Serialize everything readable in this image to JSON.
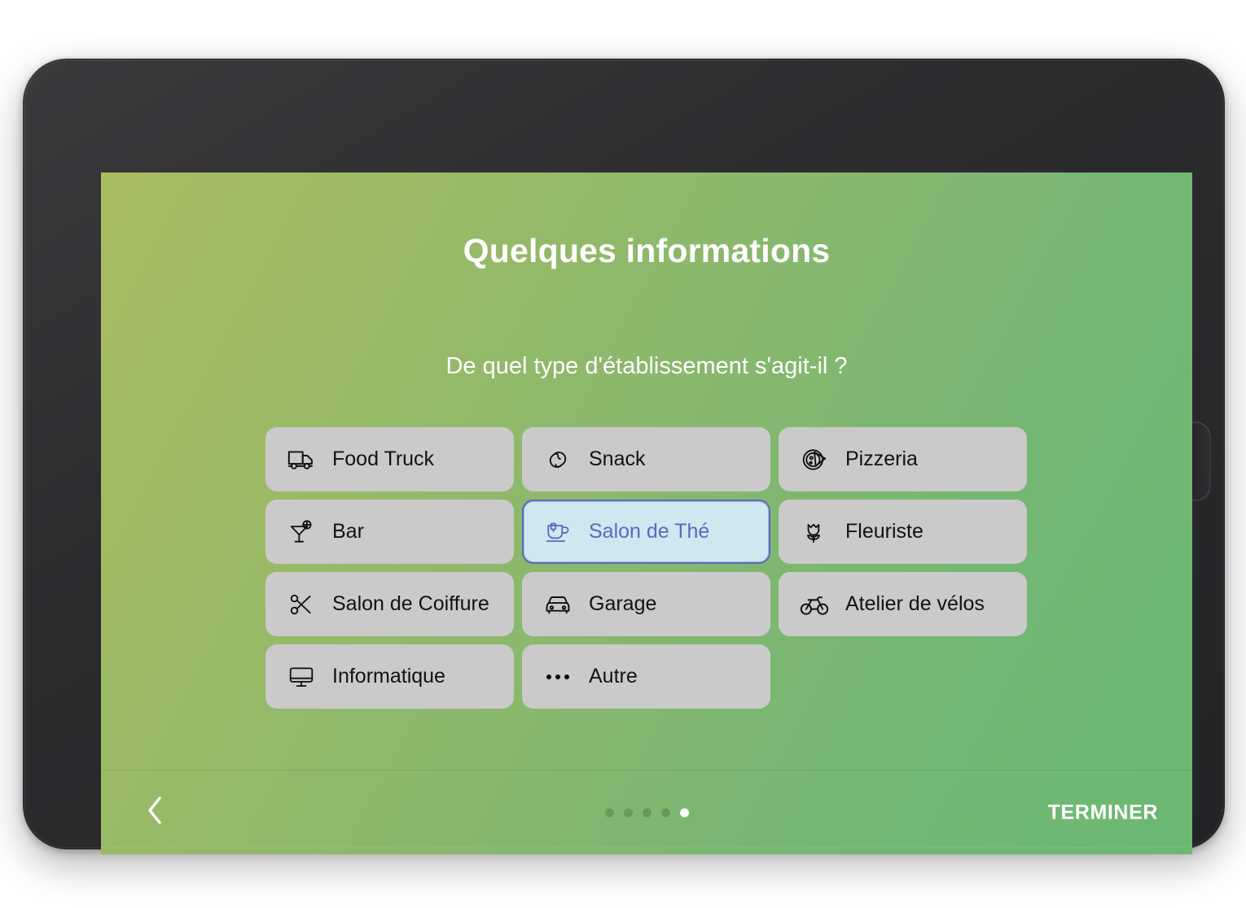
{
  "device": {
    "type": "tablet",
    "frame_color": "#2c2c2f",
    "side_button_name": "home-button"
  },
  "screen": {
    "background_gradient_from": "#a9bd60",
    "background_gradient_to": "#6bb873"
  },
  "header": {
    "title": "Quelques informations",
    "question": "De quel type d'établissement s'agit-il ?"
  },
  "options": {
    "selected_value": "salon-de-the",
    "selected_bg": "#cfe7ef",
    "selected_border": "#5a69bd",
    "selected_text": "#5a69bd",
    "unselected_bg": "#cacaca",
    "unselected_text": "#121212",
    "items": [
      {
        "value": "food-truck",
        "label": "Food Truck",
        "icon": "truck-icon",
        "selected": false
      },
      {
        "value": "snack",
        "label": "Snack",
        "icon": "sandwich-icon",
        "selected": false
      },
      {
        "value": "pizzeria",
        "label": "Pizzeria",
        "icon": "pizza-icon",
        "selected": false
      },
      {
        "value": "bar",
        "label": "Bar",
        "icon": "cocktail-icon",
        "selected": false
      },
      {
        "value": "salon-de-the",
        "label": "Salon de Thé",
        "icon": "teacup-icon",
        "selected": true
      },
      {
        "value": "fleuriste",
        "label": "Fleuriste",
        "icon": "tulip-icon",
        "selected": false
      },
      {
        "value": "salon-de-coiffure",
        "label": "Salon de Coiffure",
        "icon": "scissors-icon",
        "selected": false
      },
      {
        "value": "garage",
        "label": "Garage",
        "icon": "car-icon",
        "selected": false
      },
      {
        "value": "atelier-de-velos",
        "label": "Atelier de vélos",
        "icon": "bicycle-icon",
        "selected": false
      },
      {
        "value": "informatique",
        "label": "Informatique",
        "icon": "monitor-icon",
        "selected": false
      },
      {
        "value": "autre",
        "label": "Autre",
        "icon": "ellipsis-icon",
        "selected": false
      }
    ]
  },
  "footer": {
    "back_icon": "chevron-left-icon",
    "finish_label": "TERMINER",
    "pagination": {
      "total": 5,
      "active_index": 4,
      "active_color": "#ffffff",
      "inactive_color": "rgba(0,0,0,0.17)"
    }
  }
}
